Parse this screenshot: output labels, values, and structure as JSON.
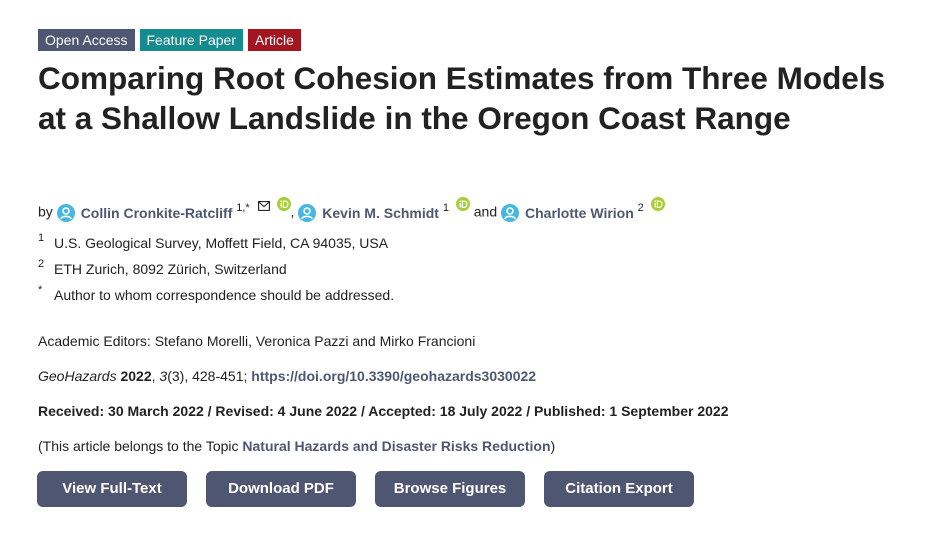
{
  "badges": {
    "open_access": "Open Access",
    "feature_paper": "Feature Paper",
    "article": "Article"
  },
  "title": "Comparing Root Cohesion Estimates from Three Models at a Shallow Landslide in the Oregon Coast Range",
  "authors": {
    "by": "by",
    "list": [
      {
        "name": "Collin Cronkite-Ratcliff",
        "sup": "1,*"
      },
      {
        "name": "Kevin M. Schmidt",
        "sup": "1"
      },
      {
        "name": "Charlotte Wirion",
        "sup": "2"
      }
    ],
    "comma": ",",
    "and": "and"
  },
  "affiliations": [
    {
      "num": "1",
      "text": "U.S. Geological Survey, Moffett Field, CA 94035, USA"
    },
    {
      "num": "2",
      "text": "ETH Zurich, 8092 Zürich, Switzerland"
    },
    {
      "num": "*",
      "text": "Author to whom correspondence should be addressed."
    }
  ],
  "editors": "Academic Editors: Stefano Morelli, Veronica Pazzi and Mirko Francioni",
  "citation": {
    "journal": "GeoHazards",
    "year": "2022",
    "volume": "3",
    "issue_pages": "(3), 428-451; ",
    "doi": "https://doi.org/10.3390/geohazards3030022"
  },
  "dates": "Received: 30 March 2022 / Revised: 4 June 2022 / Accepted: 18 July 2022 / Published: 1 September 2022",
  "topic": {
    "prefix": "(This article belongs to the Topic ",
    "link": "Natural Hazards and Disaster Risks Reduction",
    "suffix": ")"
  },
  "buttons": {
    "full_text": "View Full-Text",
    "pdf": "Download PDF",
    "figures": "Browse Figures",
    "citation": "Citation Export"
  },
  "colors": {
    "accent": "#4f5671",
    "teal": "#138b8f",
    "red": "#a31621",
    "orcid": "#a6ce39",
    "user_icon": "#46b6e3"
  },
  "icons": [
    "user-icon",
    "mail-icon",
    "orcid-icon"
  ]
}
